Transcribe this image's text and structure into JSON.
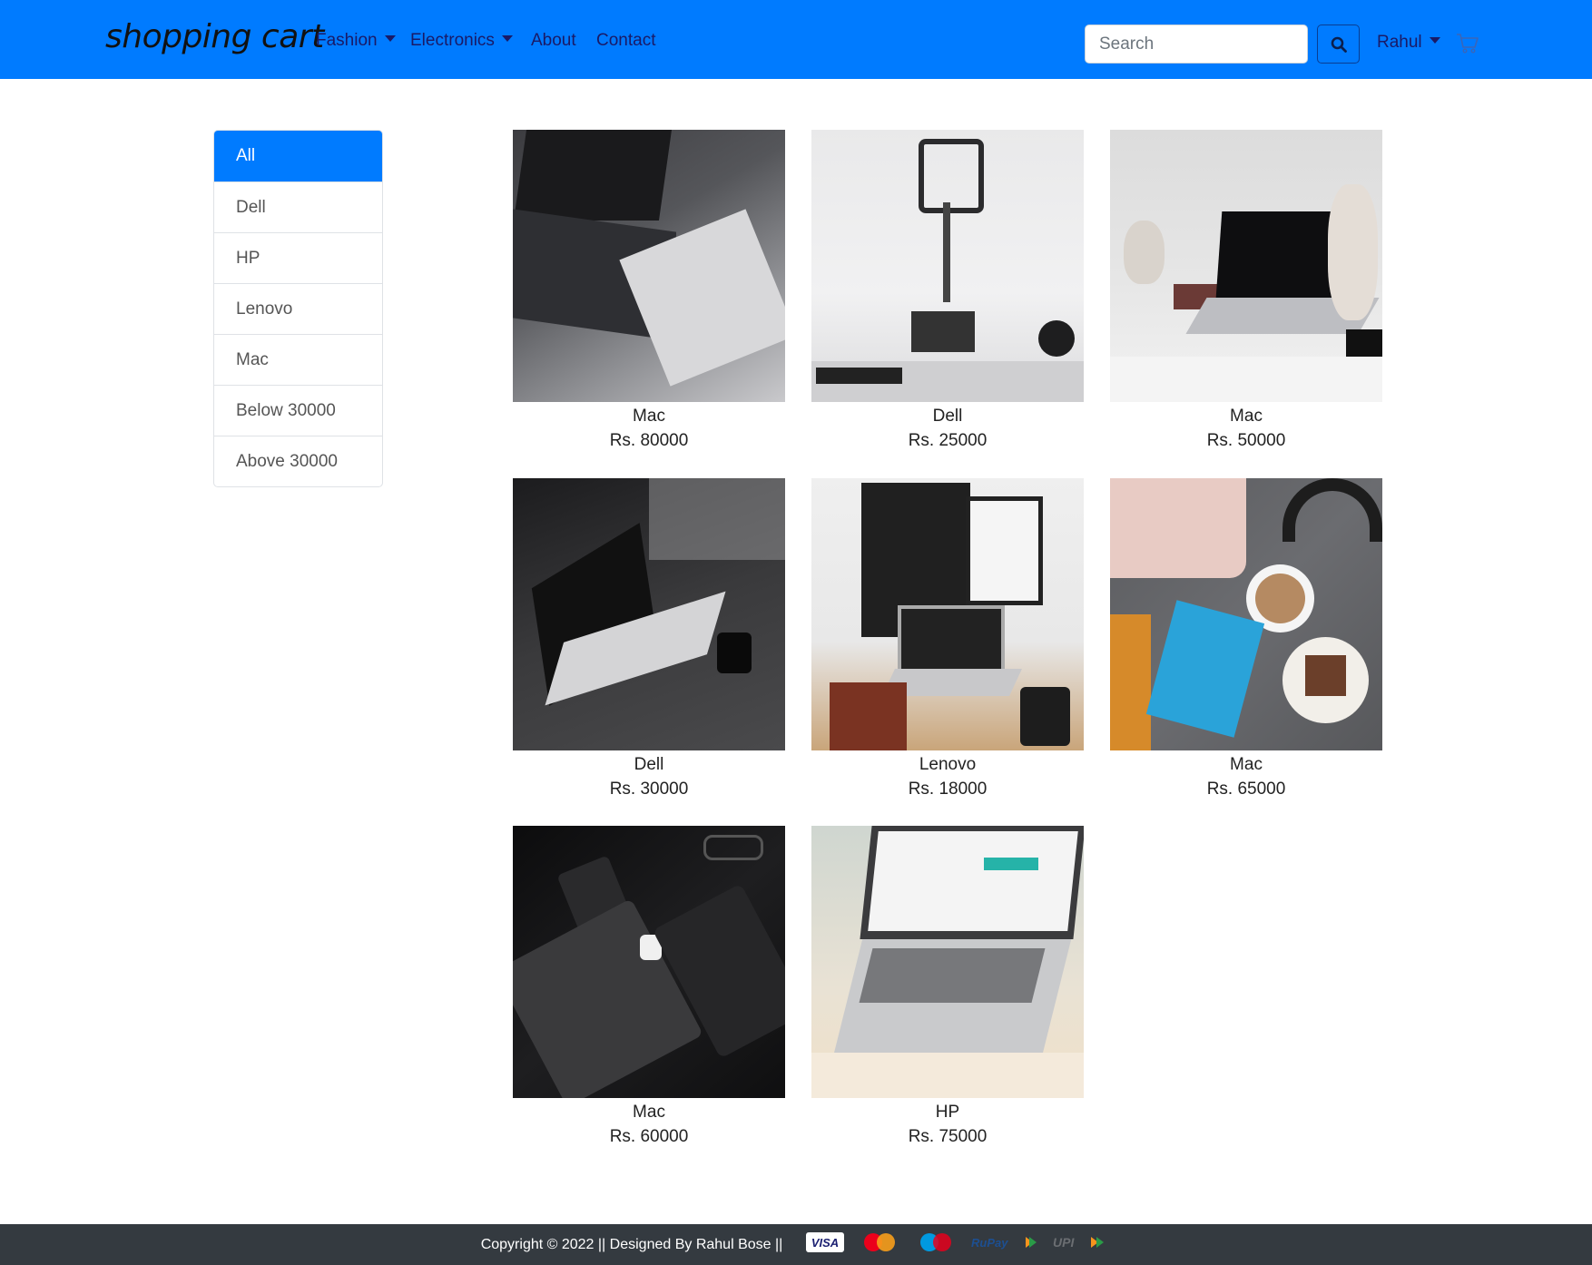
{
  "navbar": {
    "brand": "shopping cart",
    "links": [
      {
        "label": "Fashion",
        "dropdown": true
      },
      {
        "label": "Electronics",
        "dropdown": true
      },
      {
        "label": "About",
        "dropdown": false
      },
      {
        "label": "Contact",
        "dropdown": false
      }
    ],
    "search": {
      "placeholder": "Search",
      "value": ""
    },
    "search_button_icon": "search-icon",
    "user": "Rahul",
    "cart_icon": "cart-icon"
  },
  "filters": {
    "items": [
      "All",
      "Dell",
      "HP",
      "Lenovo",
      "Mac",
      "Below 30000",
      "Above 30000"
    ],
    "active": "All"
  },
  "products": [
    {
      "name": "Mac",
      "price": "Rs. 80000"
    },
    {
      "name": "Dell",
      "price": "Rs. 25000"
    },
    {
      "name": "Mac",
      "price": "Rs. 50000"
    },
    {
      "name": "Dell",
      "price": "Rs. 30000"
    },
    {
      "name": "Lenovo",
      "price": "Rs. 18000"
    },
    {
      "name": "Mac",
      "price": "Rs. 65000"
    },
    {
      "name": "Mac",
      "price": "Rs. 60000"
    },
    {
      "name": "HP",
      "price": "Rs. 75000"
    }
  ],
  "footer": {
    "text": "Copyright © 2022 || Designed By Rahul Bose ||",
    "payment_logos": [
      "VISA",
      "MasterCard",
      "Maestro",
      "RuPay",
      "UPI"
    ]
  },
  "colors": {
    "primary": "#007bff",
    "footer_bg": "#343a40"
  }
}
